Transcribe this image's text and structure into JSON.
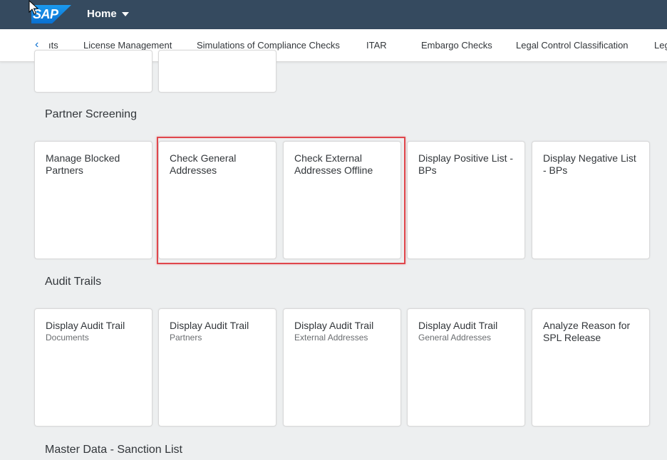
{
  "shell": {
    "logo_text": "SAP",
    "home_label": "Home"
  },
  "anchor_nav": {
    "back_icon": "‹",
    "items": [
      "ıts",
      "License Management",
      "Simulations of Compliance Checks",
      "ITAR",
      "Embargo Checks",
      "Legal Control Classification",
      "Leg"
    ]
  },
  "groups": {
    "partner_screening": {
      "title": "Partner Screening",
      "tiles": [
        {
          "title": "Manage Blocked Partners",
          "subtitle": ""
        },
        {
          "title": "Check General Addresses",
          "subtitle": ""
        },
        {
          "title": "Check External Addresses Offline",
          "subtitle": ""
        },
        {
          "title": "Display Positive List - BPs",
          "subtitle": ""
        },
        {
          "title": "Display Negative List - BPs",
          "subtitle": ""
        }
      ]
    },
    "audit_trails": {
      "title": "Audit Trails",
      "tiles": [
        {
          "title": "Display Audit Trail",
          "subtitle": "Documents"
        },
        {
          "title": "Display Audit Trail",
          "subtitle": "Partners"
        },
        {
          "title": "Display Audit Trail",
          "subtitle": "External Addresses"
        },
        {
          "title": "Display Audit Trail",
          "subtitle": "General Addresses"
        },
        {
          "title": "Analyze Reason for SPL Release",
          "subtitle": ""
        }
      ]
    },
    "master_data": {
      "title": "Master Data - Sanction List"
    }
  },
  "colors": {
    "shell": "#354a5f",
    "background": "#edeff0",
    "highlight": "#e0474c",
    "link": "#0a6ed1"
  }
}
